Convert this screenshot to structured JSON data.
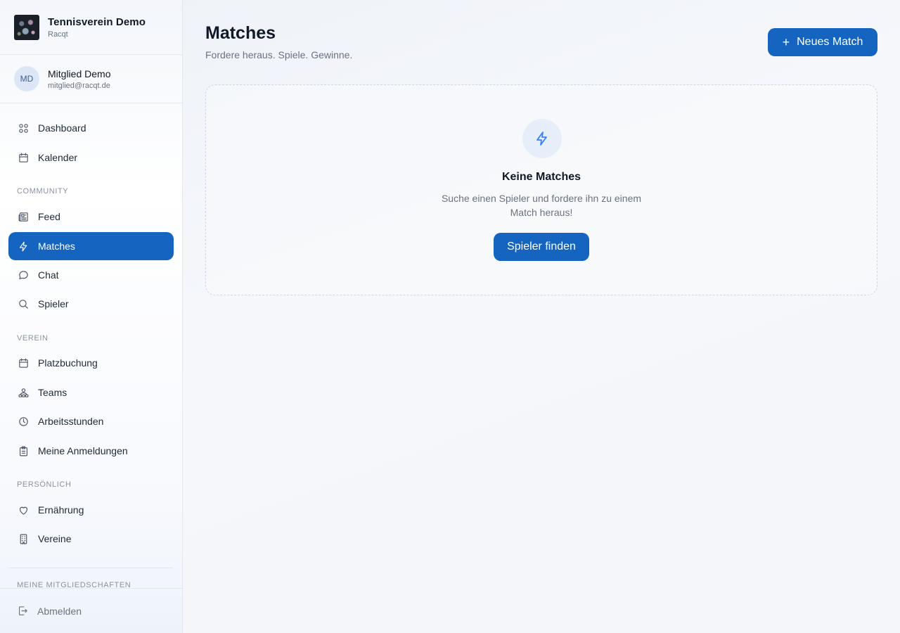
{
  "brand": {
    "name": "Tennisverein Demo",
    "subtitle": "Racqt"
  },
  "user": {
    "initials": "MD",
    "name": "Mitglied Demo",
    "email": "mitglied@racqt.de"
  },
  "sidebar": {
    "items": [
      {
        "label": "Dashboard",
        "icon": "dashboard-icon"
      },
      {
        "label": "Kalender",
        "icon": "calendar-icon"
      },
      {
        "label": "Feed",
        "icon": "newspaper-icon"
      },
      {
        "label": "Matches",
        "icon": "lightning-icon",
        "active": true
      },
      {
        "label": "Chat",
        "icon": "chat-bubble-icon"
      },
      {
        "label": "Spieler",
        "icon": "search-icon"
      },
      {
        "label": "Platzbuchung",
        "icon": "calendar-icon"
      },
      {
        "label": "Teams",
        "icon": "team-icon"
      },
      {
        "label": "Arbeitsstunden",
        "icon": "clock-icon"
      },
      {
        "label": "Meine Anmeldungen",
        "icon": "clipboard-icon"
      },
      {
        "label": "Ernährung",
        "icon": "heart-icon"
      },
      {
        "label": "Vereine",
        "icon": "building-icon"
      }
    ],
    "sections": {
      "community": "COMMUNITY",
      "verein": "VEREIN",
      "persoenlich": "PERSÖNLICH",
      "mitgliedschaften": "MEINE MITGLIEDSCHAFTEN"
    },
    "logout": "Abmelden"
  },
  "main": {
    "title": "Matches",
    "subtitle": "Fordere heraus. Spiele. Gewinne.",
    "new_match_label": "Neues Match",
    "empty": {
      "title": "Keine Matches",
      "text": "Suche einen Spieler und fordere ihn zu einem Match heraus!",
      "button": "Spieler finden"
    }
  },
  "colors": {
    "accent": "#1565c0",
    "icon_accent": "#3b82f6"
  }
}
